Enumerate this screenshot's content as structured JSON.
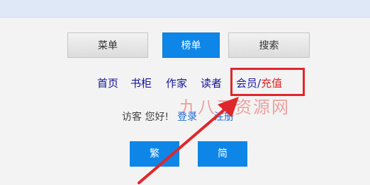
{
  "tabs": [
    {
      "label": "菜单"
    },
    {
      "label": "榜单"
    },
    {
      "label": "搜索"
    }
  ],
  "nav": {
    "home": "首页",
    "bookshelf": "书柜",
    "author": "作家",
    "reader": "读者",
    "vip_member": "会员",
    "vip_slash": "/",
    "vip_recharge": "充值"
  },
  "greeting": {
    "text": "访客 您好!",
    "login": "登录",
    "register": "注册"
  },
  "language": {
    "traditional": "繁",
    "simplified": "简"
  },
  "watermark": "九八五资源网",
  "colors": {
    "accent_blue": "#0e86e8",
    "nav_link": "#13139a",
    "highlight_red": "#e0262b",
    "link_blue": "#1d6fd8"
  }
}
